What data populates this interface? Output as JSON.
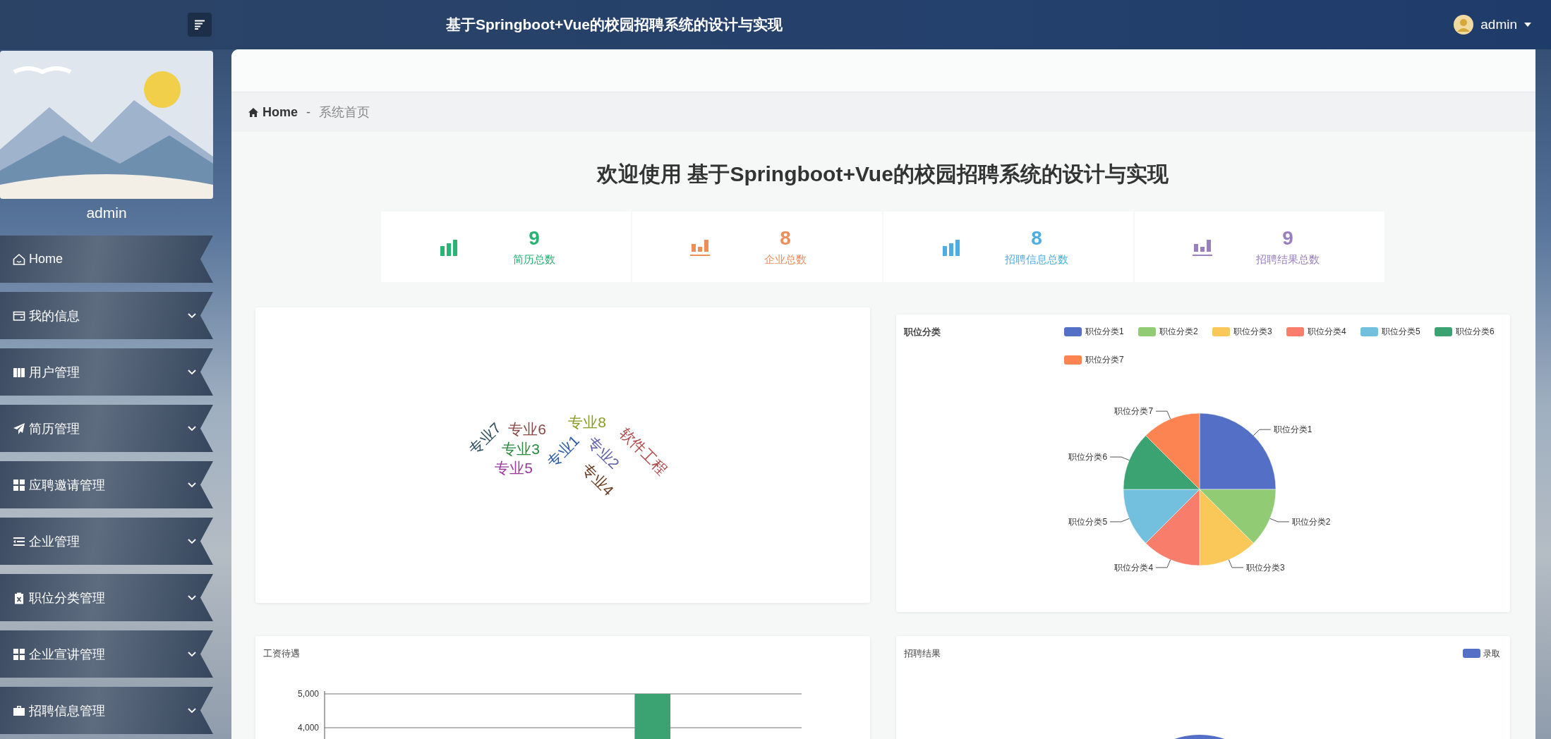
{
  "header": {
    "title": "基于Springboot+Vue的校园招聘系统的设计与实现",
    "user": "admin"
  },
  "sidebar": {
    "username": "admin",
    "menu": [
      {
        "label": "Home",
        "expandable": false
      },
      {
        "label": "我的信息",
        "expandable": true
      },
      {
        "label": "用户管理",
        "expandable": true
      },
      {
        "label": "简历管理",
        "expandable": true
      },
      {
        "label": "应聘邀请管理",
        "expandable": true
      },
      {
        "label": "企业管理",
        "expandable": true
      },
      {
        "label": "职位分类管理",
        "expandable": true
      },
      {
        "label": "企业宣讲管理",
        "expandable": true
      },
      {
        "label": "招聘信息管理",
        "expandable": true
      }
    ]
  },
  "breadcrumb": {
    "home": "Home",
    "separator": "-",
    "current": "系统首页"
  },
  "welcome": "欢迎使用 基于Springboot+Vue的校园招聘系统的设计与实现",
  "stats": [
    {
      "value": "9",
      "label": "简历总数",
      "color": "#28b472"
    },
    {
      "value": "8",
      "label": "企业总数",
      "color": "#ee8e5a"
    },
    {
      "value": "8",
      "label": "招聘信息总数",
      "color": "#4eaee3"
    },
    {
      "value": "9",
      "label": "招聘结果总数",
      "color": "#9a7fc0"
    }
  ],
  "word_cloud": {
    "words": [
      {
        "text": "专业7",
        "color": "#2f5060"
      },
      {
        "text": "专业6",
        "color": "#8b4848"
      },
      {
        "text": "专业3",
        "color": "#2a8a40"
      },
      {
        "text": "专业5",
        "color": "#9a3a9a"
      },
      {
        "text": "专业8",
        "color": "#8a9a28"
      },
      {
        "text": "专业1",
        "color": "#2a5aa8"
      },
      {
        "text": "专业2",
        "color": "#6060a8"
      },
      {
        "text": "专业4",
        "color": "#6a3a20"
      },
      {
        "text": "软件工程",
        "color": "#b04848"
      }
    ]
  },
  "position_chart": {
    "chart_data": {
      "type": "pie",
      "title": "职位分类",
      "categories": [
        "职位分类1",
        "职位分类2",
        "职位分类3",
        "职位分类4",
        "职位分类5",
        "职位分类6",
        "职位分类7"
      ],
      "values": [
        25,
        12.5,
        12.5,
        12.5,
        12.5,
        12.5,
        12.5
      ],
      "legend": "top-right"
    }
  },
  "salary_chart": {
    "chart_data": {
      "type": "bar",
      "title": "工资待遇",
      "values": [
        null,
        null,
        null,
        null,
        null,
        5000,
        null,
        null
      ],
      "ylim": [
        0,
        5000
      ],
      "yticks": [
        {
          "value": 4000,
          "label": "4,000"
        },
        {
          "value": 5000,
          "label": "5,000"
        }
      ]
    }
  },
  "result_chart": {
    "title": "招聘结果",
    "legend": [
      "录取"
    ]
  }
}
